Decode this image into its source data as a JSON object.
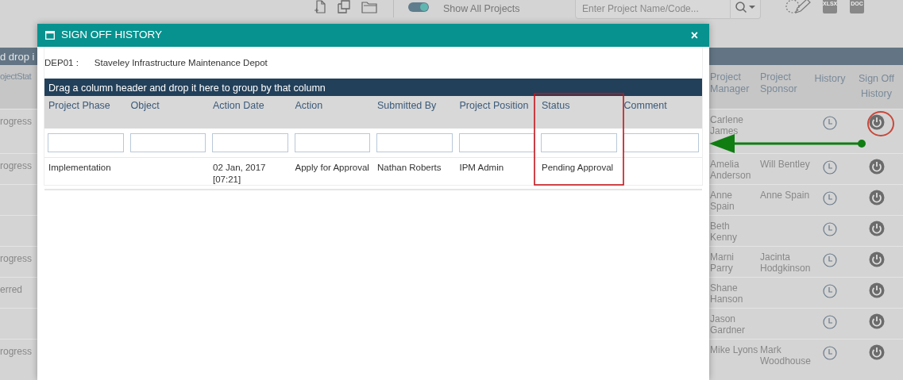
{
  "toolbar": {
    "toggle": {
      "label": "Show All Projects",
      "on": true
    },
    "search": {
      "placeholder": "Enter Project Name/Code..."
    },
    "export_labels": [
      "XLSX",
      "DOC"
    ]
  },
  "background_grid": {
    "group_bar_text": "d drop i",
    "left_header": "ojectStat",
    "columns": [
      "Project Manager",
      "Project Sponsor",
      "History",
      "Sign Off History"
    ],
    "rows": [
      {
        "status": "rogress",
        "manager": "Carlene James"
      },
      {
        "status": "rogress",
        "manager": "Amelia Anderson",
        "sponsor": "Will Bentley"
      },
      {
        "manager": "Anne Spain",
        "sponsor": "Anne Spain"
      },
      {
        "manager": "Beth Kenny"
      },
      {
        "status": "rogress",
        "manager": "Marni Parry",
        "sponsor": "Jacinta Hodgkinson"
      },
      {
        "status": "erred",
        "manager": "Shane Hanson"
      },
      {
        "manager": "Jason Gardner"
      },
      {
        "status": "rogress",
        "manager": "Mike Lyons",
        "sponsor": "Mark Woodhouse"
      }
    ]
  },
  "modal": {
    "title": "SIGN OFF HISTORY",
    "close": "×",
    "project_code": "DEP01 :",
    "project_name": "Staveley Infrastructure Maintenance Depot",
    "group_hint": "Drag a column header and drop it here to group by that column",
    "columns": [
      "Project Phase",
      "Object",
      "Action Date",
      "Action",
      "Submitted By",
      "Project Position",
      "Status",
      "Comment"
    ],
    "rows": [
      {
        "cells": [
          "Implementation",
          null,
          "02 Jan, 2017 [07:21]",
          "Apply for Approval",
          "Nathan Roberts",
          "IPM Admin",
          "Pending Approval",
          null
        ]
      }
    ]
  }
}
